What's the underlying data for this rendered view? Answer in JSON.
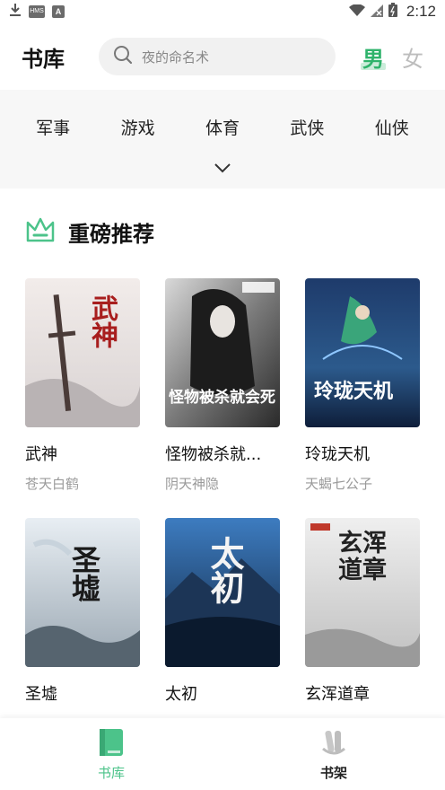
{
  "status_bar": {
    "time": "2:12",
    "left_icons": [
      "download-icon",
      "hms-icon",
      "a-icon"
    ],
    "right_icons": [
      "wifi-icon",
      "no-signal-icon",
      "battery-icon"
    ],
    "hms_label": "HMS",
    "a_label": "A"
  },
  "header": {
    "title": "书库",
    "search_placeholder": "夜的命名术",
    "gender_male": "男",
    "gender_female": "女"
  },
  "categories": [
    "军事",
    "游戏",
    "体育",
    "武侠",
    "仙侠"
  ],
  "section": {
    "title": "重磅推荐"
  },
  "books": [
    {
      "title": "武神",
      "author": "苍天白鹤",
      "cover_text": "武神"
    },
    {
      "title": "怪物被杀就...",
      "author": "阴天神隐",
      "cover_text": "怪物被杀就会死"
    },
    {
      "title": "玲珑天机",
      "author": "天蝎七公子",
      "cover_text": "玲珑天机"
    },
    {
      "title": "圣墟",
      "author": "",
      "cover_text": "圣墟"
    },
    {
      "title": "太初",
      "author": "",
      "cover_text": "太初"
    },
    {
      "title": "玄浑道章",
      "author": "",
      "cover_text": "玄浑道章"
    }
  ],
  "bottom_nav": {
    "library": "书库",
    "shelf": "书架"
  },
  "colors": {
    "accent": "#4cc38a",
    "male_accent": "#2fb36b"
  }
}
